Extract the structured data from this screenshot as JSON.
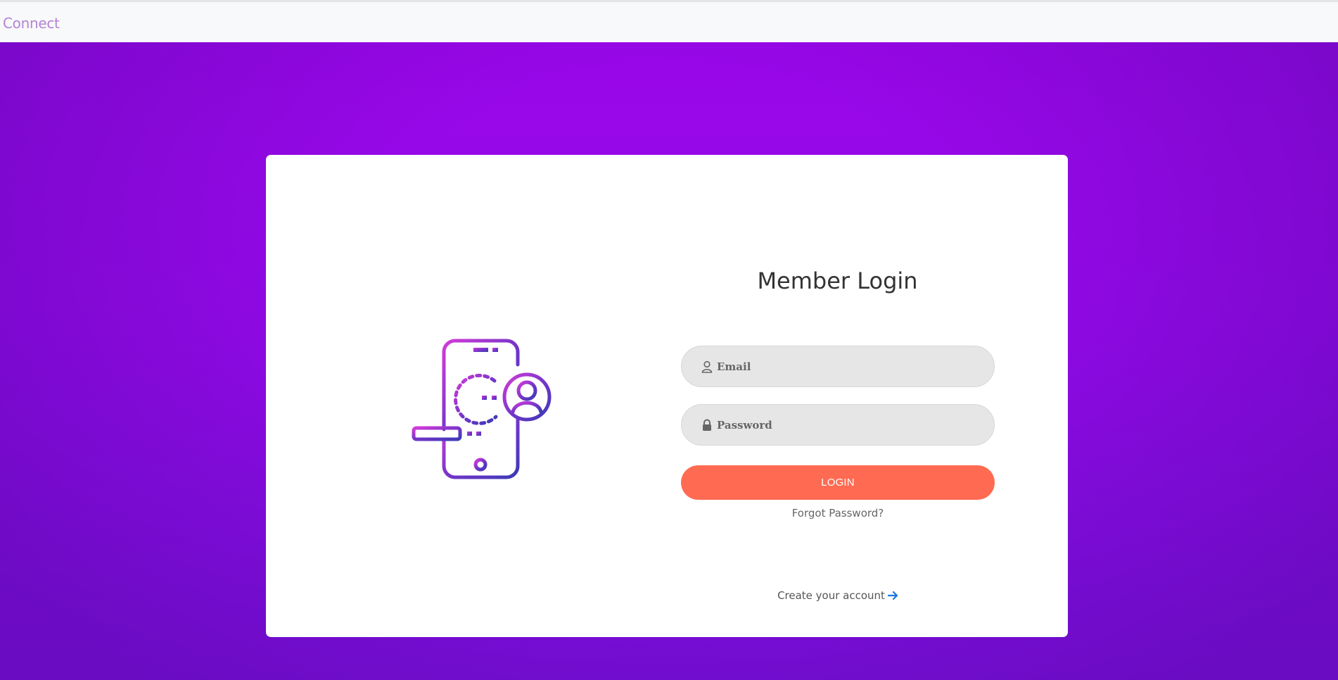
{
  "navbar": {
    "brand": "Connect",
    "brand_color": "#b582d6"
  },
  "login": {
    "title": "Member Login",
    "email_placeholder": "Email",
    "password_placeholder": "Password",
    "login_button": "LOGIN",
    "forgot_link": "Forgot Password?",
    "create_account_link": "Create your account",
    "button_color": "#ff6b52",
    "background_color": "#9a07e9"
  },
  "icons": {
    "illustration": "mobile-login-illustration",
    "email": "user-icon",
    "password": "lock-icon",
    "create_account": "arrow-right-icon"
  }
}
